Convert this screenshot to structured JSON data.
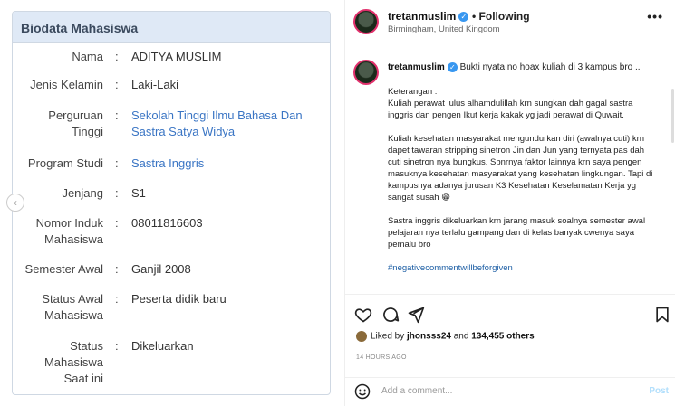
{
  "biodata": {
    "title": "Biodata Mahasiswa",
    "rows": [
      {
        "label": "Nama",
        "value": "ADITYA MUSLIM",
        "link": false
      },
      {
        "label": "Jenis Kelamin",
        "value": "Laki-Laki",
        "link": false
      },
      {
        "label": "Perguruan\nTinggi",
        "value": "Sekolah Tinggi Ilmu Bahasa Dan Sastra Satya Widya",
        "link": true
      },
      {
        "label": "Program Studi",
        "value": "Sastra Inggris",
        "link": true
      },
      {
        "label": "Jenjang",
        "value": "S1",
        "link": false
      },
      {
        "label": "Nomor Induk\nMahasiswa",
        "value": "08011816603",
        "link": false
      },
      {
        "label": "Semester Awal",
        "value": "Ganjil 2008",
        "link": false
      },
      {
        "label": "Status Awal\nMahasiswa",
        "value": "Peserta didik baru",
        "link": false
      },
      {
        "label": "Status\nMahasiswa\nSaat ini",
        "value": "Dikeluarkan",
        "link": false
      }
    ],
    "separator": ":"
  },
  "post": {
    "username": "tretanmuslim",
    "following_label": "Following",
    "location": "Birmingham, United Kingdom",
    "caption_intro": "Bukti nyata no hoax kuliah di 3 kampus bro ..",
    "paragraphs": [
      "Keterangan :\nKuliah perawat lulus alhamdulillah krn sungkan dah gagal sastra inggris dan pengen Ikut kerja kakak yg jadi perawat di Quwait.",
      "Kuliah kesehatan masyarakat mengundurkan diri (awalnya cuti) krn dapet tawaran stripping sinetron Jin dan Jun yang ternyata pas dah cuti sinetron nya bungkus. Sbnrnya faktor lainnya krn saya pengen masuknya kesehatan masyarakat yang kesehatan lingkungan. Tapi di kampusnya adanya jurusan K3 Kesehatan Keselamatan Kerja yg sangat susah 😁",
      "Sastra inggris dikeluarkan krn jarang masuk soalnya semester awal pelajaran nya terlalu gampang dan di kelas banyak cwenya saya pemalu bro"
    ],
    "hashtag": "#negativecommentwillbeforgiven",
    "liked_by_prefix": "Liked by",
    "liked_by_user": "jhonsss24",
    "liked_by_and": "and",
    "liked_by_count": "134,455 others",
    "timestamp": "14 HOURS AGO",
    "comment_placeholder": "Add a comment...",
    "post_label": "Post",
    "more_icon": "•••"
  },
  "colors": {
    "link": "#3a75c4",
    "header_bg": "#dfe9f6",
    "verified": "#3897f0"
  }
}
